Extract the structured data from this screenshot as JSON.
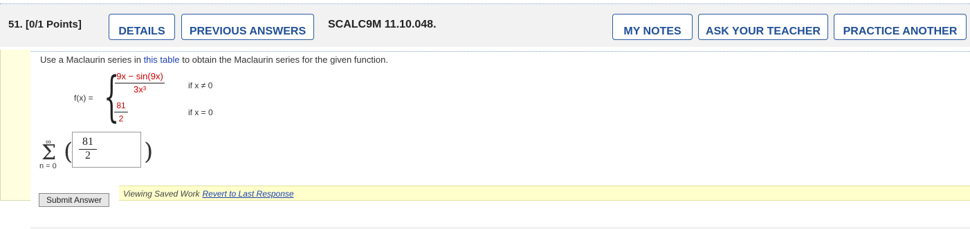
{
  "question": {
    "number_points": "51.  [0/1 Points]",
    "code": "SCALC9M 11.10.048."
  },
  "buttons": {
    "details": "DETAILS",
    "previous_answers": "PREVIOUS ANSWERS",
    "my_notes": "MY NOTES",
    "ask_teacher": "ASK YOUR TEACHER",
    "practice_another": "PRACTICE ANOTHER"
  },
  "instruction": {
    "before": "Use a Maclaurin series in ",
    "link": "this table",
    "after": " to obtain the Maclaurin series for the given function."
  },
  "function": {
    "lhs": "f(x) =",
    "case1_num": "9x − sin(9x)",
    "case1_den": "3x³",
    "case1_cond": "if x ≠ 0",
    "case2_num": "81",
    "case2_den": "2",
    "case2_cond": "if x = 0"
  },
  "series": {
    "upper": "∞",
    "sigma": "Σ",
    "lower": "n = 0",
    "paren_left": "(",
    "paren_right": ")",
    "answer_num": "81",
    "answer_den": "2"
  },
  "submit_label": "Submit Answer",
  "saved_work": {
    "text": "Viewing Saved Work",
    "revert": "Revert to Last Response"
  },
  "colors": {
    "accent": "#1f4f99",
    "answer_red": "#c00000",
    "highlight_yellow": "#ffffcc"
  }
}
